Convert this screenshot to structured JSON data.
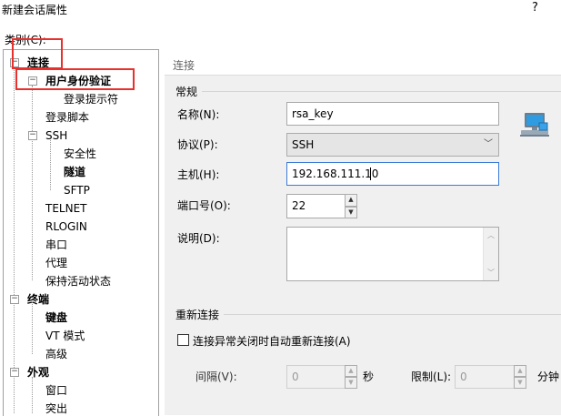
{
  "window": {
    "title": "新建会话属性",
    "help": "?"
  },
  "category_label": "类别(C):",
  "tree": [
    {
      "label": "连接",
      "level": 0,
      "bold": true
    },
    {
      "label": "用户身份验证",
      "level": 1,
      "bold": true
    },
    {
      "label": "登录提示符",
      "level": 2,
      "bold": false
    },
    {
      "label": "登录脚本",
      "level": 1,
      "bold": false
    },
    {
      "label": "SSH",
      "level": 1,
      "bold": false
    },
    {
      "label": "安全性",
      "level": 2,
      "bold": false
    },
    {
      "label": "隧道",
      "level": 2,
      "bold": true
    },
    {
      "label": "SFTP",
      "level": 2,
      "bold": false
    },
    {
      "label": "TELNET",
      "level": 1,
      "bold": false
    },
    {
      "label": "RLOGIN",
      "level": 1,
      "bold": false
    },
    {
      "label": "串口",
      "level": 1,
      "bold": false
    },
    {
      "label": "代理",
      "level": 1,
      "bold": false
    },
    {
      "label": "保持活动状态",
      "level": 1,
      "bold": false
    },
    {
      "label": "终端",
      "level": 0,
      "bold": true
    },
    {
      "label": "键盘",
      "level": 1,
      "bold": true
    },
    {
      "label": "VT 模式",
      "level": 1,
      "bold": false
    },
    {
      "label": "高级",
      "level": 1,
      "bold": false
    },
    {
      "label": "外观",
      "level": 0,
      "bold": true
    },
    {
      "label": "窗口",
      "level": 1,
      "bold": false
    },
    {
      "label": "突出",
      "level": 1,
      "bold": false
    }
  ],
  "panel": {
    "header": "连接",
    "general": {
      "title": "常规",
      "name_label": "名称(N):",
      "name_value": "rsa_key",
      "protocol_label": "协议(P):",
      "protocol_value": "SSH",
      "host_label": "主机(H):",
      "host_value": "192.168.111.10",
      "port_label": "端口号(O):",
      "port_value": "22",
      "desc_label": "说明(D):"
    },
    "reconnect": {
      "title": "重新连接",
      "auto_label": "连接异常关闭时自动重新连接(A)",
      "interval_label": "间隔(V):",
      "interval_value": "0",
      "interval_unit": "秒",
      "limit_label": "限制(L):",
      "limit_value": "0",
      "limit_unit": "分钟"
    }
  },
  "icons": {
    "expander_minus": "−",
    "spin_up": "▲",
    "spin_down": "▼",
    "combo_arrow": "﹀",
    "scroll_up": "︿",
    "scroll_down": "﹀"
  },
  "colors": {
    "highlight_box": "#e8302c",
    "panel_bg": "#f0f0f0",
    "focus_border": "#3b7bd4"
  }
}
